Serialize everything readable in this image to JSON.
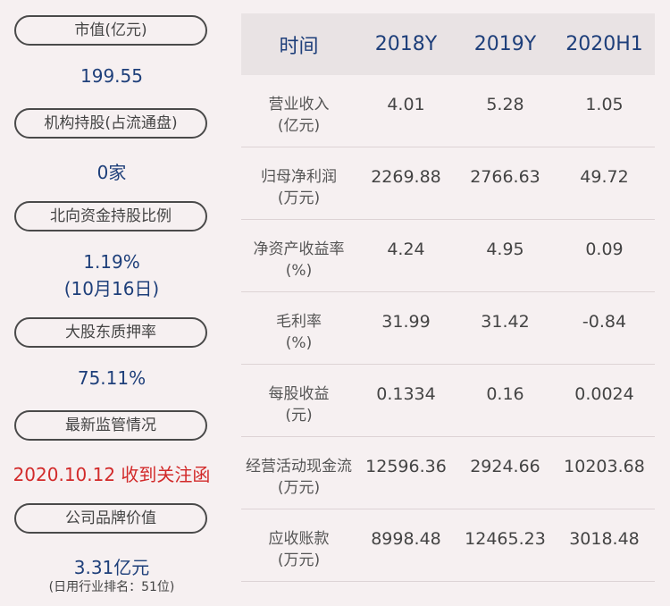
{
  "left": {
    "market_cap": {
      "label": "市值(亿元)",
      "value": "199.55"
    },
    "institution": {
      "label": "机构持股(占流通盘)",
      "value": "0家"
    },
    "northbound": {
      "label": "北向资金持股比例",
      "value": "1.19%",
      "date": "(10月16日)"
    },
    "pledge": {
      "label": "大股东质押率",
      "value": "75.11%"
    },
    "regulation": {
      "label": "最新监管情况",
      "value": "2020.10.12 收到关注函"
    },
    "brand": {
      "label": "公司品牌价值",
      "value": "3.31亿元",
      "rank": "(日用行业排名：51位)"
    }
  },
  "table": {
    "headers": [
      "时间",
      "2018Y",
      "2019Y",
      "2020H1"
    ],
    "rows": [
      {
        "name": "营业收入",
        "unit": "(亿元)",
        "values": [
          "4.01",
          "5.28",
          "1.05"
        ]
      },
      {
        "name": "归母净利润",
        "unit": "(万元)",
        "values": [
          "2269.88",
          "2766.63",
          "49.72"
        ]
      },
      {
        "name": "净资产收益率",
        "unit": "(%)",
        "values": [
          "4.24",
          "4.95",
          "0.09"
        ]
      },
      {
        "name": "毛利率",
        "unit": "(%)",
        "values": [
          "31.99",
          "31.42",
          "-0.84"
        ]
      },
      {
        "name": "每股收益",
        "unit": "(元)",
        "values": [
          "0.1334",
          "0.16",
          "0.0024"
        ]
      },
      {
        "name": "经营活动现金流",
        "unit": "(万元)",
        "values": [
          "12596.36",
          "2924.66",
          "10203.68"
        ]
      },
      {
        "name": "应收账款",
        "unit": "(万元)",
        "values": [
          "8998.48",
          "12465.23",
          "3018.48"
        ]
      }
    ]
  }
}
